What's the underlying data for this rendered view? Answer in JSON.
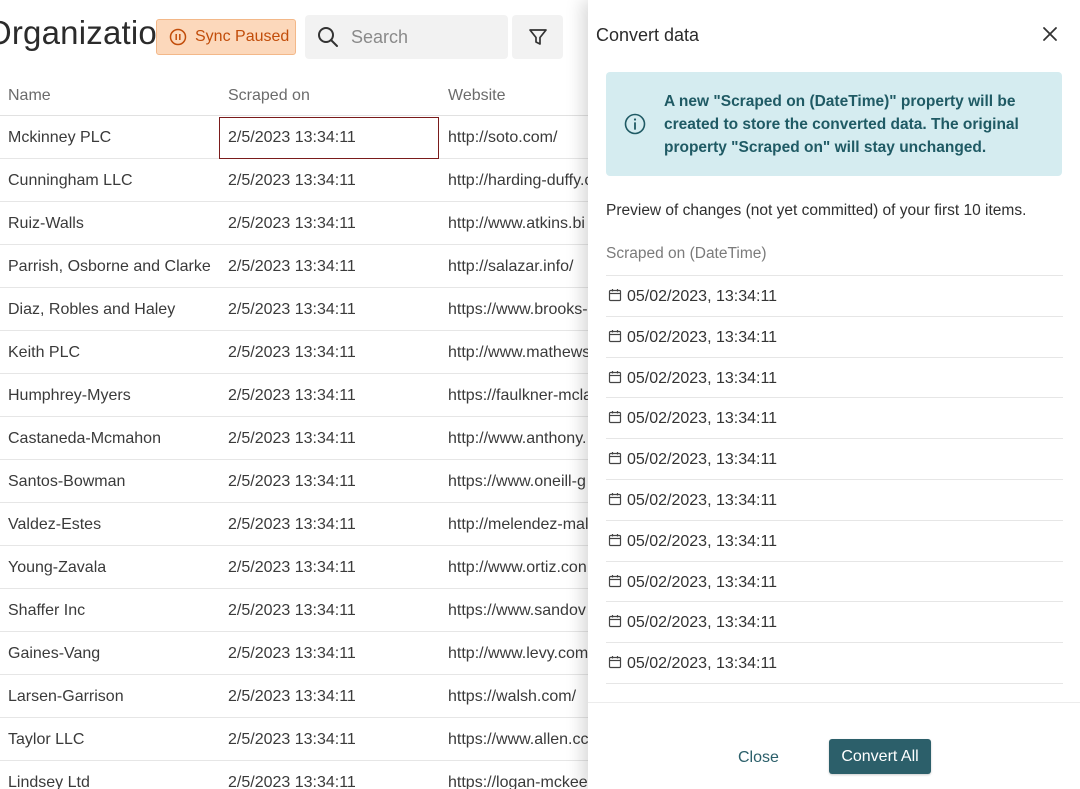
{
  "header": {
    "title": "Organizations",
    "sync_badge": "Sync Paused",
    "search_placeholder": "Search"
  },
  "table": {
    "columns": [
      "Name",
      "Scraped on",
      "Website"
    ],
    "rows": [
      {
        "name": "Mckinney PLC",
        "scraped": "2/5/2023 13:34:11",
        "website": "http://soto.com/"
      },
      {
        "name": "Cunningham LLC",
        "scraped": "2/5/2023 13:34:11",
        "website": "http://harding-duffy.c"
      },
      {
        "name": "Ruiz-Walls",
        "scraped": "2/5/2023 13:34:11",
        "website": "http://www.atkins.bi"
      },
      {
        "name": "Parrish, Osborne and Clarke",
        "scraped": "2/5/2023 13:34:11",
        "website": "http://salazar.info/"
      },
      {
        "name": "Diaz, Robles and Haley",
        "scraped": "2/5/2023 13:34:11",
        "website": "https://www.brooks-"
      },
      {
        "name": "Keith PLC",
        "scraped": "2/5/2023 13:34:11",
        "website": "http://www.mathews"
      },
      {
        "name": "Humphrey-Myers",
        "scraped": "2/5/2023 13:34:11",
        "website": "https://faulkner-mcla"
      },
      {
        "name": "Castaneda-Mcmahon",
        "scraped": "2/5/2023 13:34:11",
        "website": "http://www.anthony."
      },
      {
        "name": "Santos-Bowman",
        "scraped": "2/5/2023 13:34:11",
        "website": "https://www.oneill-g"
      },
      {
        "name": "Valdez-Estes",
        "scraped": "2/5/2023 13:34:11",
        "website": "http://melendez-mal"
      },
      {
        "name": "Young-Zavala",
        "scraped": "2/5/2023 13:34:11",
        "website": "http://www.ortiz.con"
      },
      {
        "name": "Shaffer Inc",
        "scraped": "2/5/2023 13:34:11",
        "website": "https://www.sandov"
      },
      {
        "name": "Gaines-Vang",
        "scraped": "2/5/2023 13:34:11",
        "website": "http://www.levy.com"
      },
      {
        "name": "Larsen-Garrison",
        "scraped": "2/5/2023 13:34:11",
        "website": "https://walsh.com/"
      },
      {
        "name": "Taylor LLC",
        "scraped": "2/5/2023 13:34:11",
        "website": "https://www.allen.cc"
      },
      {
        "name": "Lindsey Ltd",
        "scraped": "2/5/2023 13:34:11",
        "website": "https://logan-mckee"
      }
    ]
  },
  "panel": {
    "title": "Convert data",
    "info": "A new \"Scraped on (DateTime)\" property will be created to store the converted data. The original property \"Scraped on\" will stay unchanged.",
    "preview_text": "Preview of changes (not yet committed) of your first 10 items.",
    "column_header": "Scraped on (DateTime)",
    "items": [
      "05/02/2023, 13:34:11",
      "05/02/2023, 13:34:11",
      "05/02/2023, 13:34:11",
      "05/02/2023, 13:34:11",
      "05/02/2023, 13:34:11",
      "05/02/2023, 13:34:11",
      "05/02/2023, 13:34:11",
      "05/02/2023, 13:34:11",
      "05/02/2023, 13:34:11",
      "05/02/2023, 13:34:11"
    ],
    "close_label": "Close",
    "convert_label": "Convert All"
  },
  "colors": {
    "accent": "#2c5f6a",
    "info_bg": "#d5ecf0",
    "badge_bg": "#fcd8bb",
    "badge_text": "#c24d0a"
  },
  "icons": {
    "sync_badge": "pause-circle-icon",
    "search": "search-icon",
    "filter": "filter-icon",
    "close": "close-icon",
    "info": "info-circle-icon",
    "date": "calendar-icon"
  }
}
